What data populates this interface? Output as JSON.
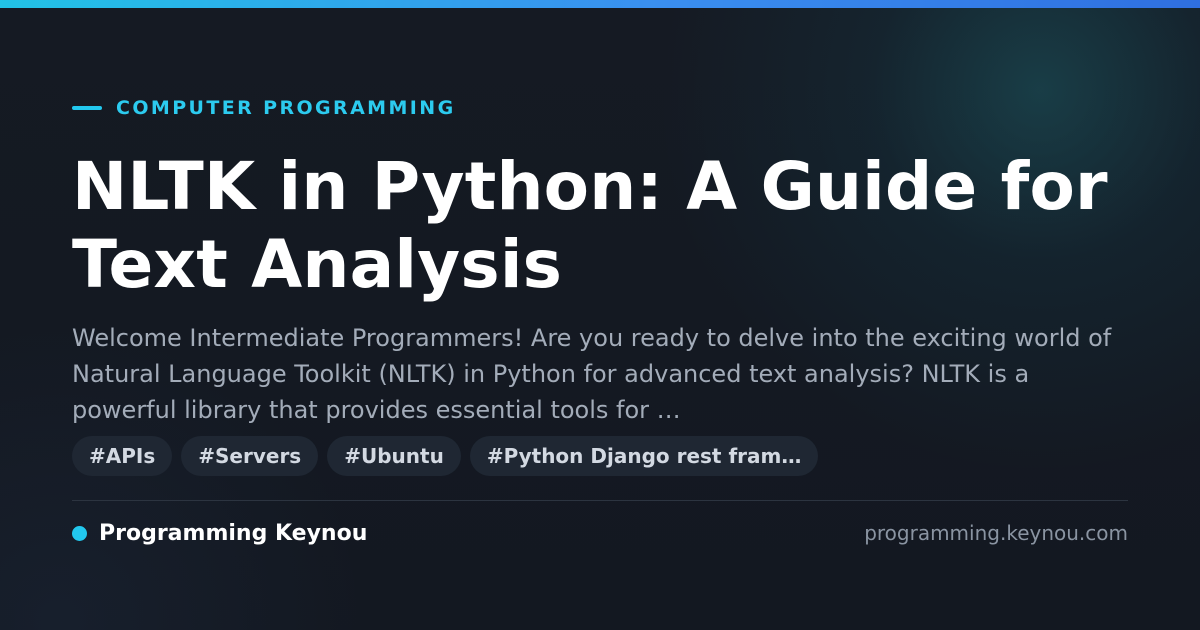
{
  "category": "COMPUTER PROGRAMMING",
  "title": "NLTK in Python: A Guide for Text Analysis",
  "description": "Welcome Intermediate Programmers! Are you ready to delve into the exciting world of Natural Language Toolkit (NLTK) in Python for advanced text analysis? NLTK is a powerful library that provides essential tools for …",
  "tags": [
    "#APIs",
    "#Servers",
    "#Ubuntu",
    "#Python Django rest fram…"
  ],
  "footer": {
    "brand": "Programming Keynou",
    "site": "programming.keynou.com"
  },
  "colors": {
    "accent": "#22c8ee",
    "background": "#141922",
    "title": "#ffffff",
    "description": "#a3acb9"
  }
}
